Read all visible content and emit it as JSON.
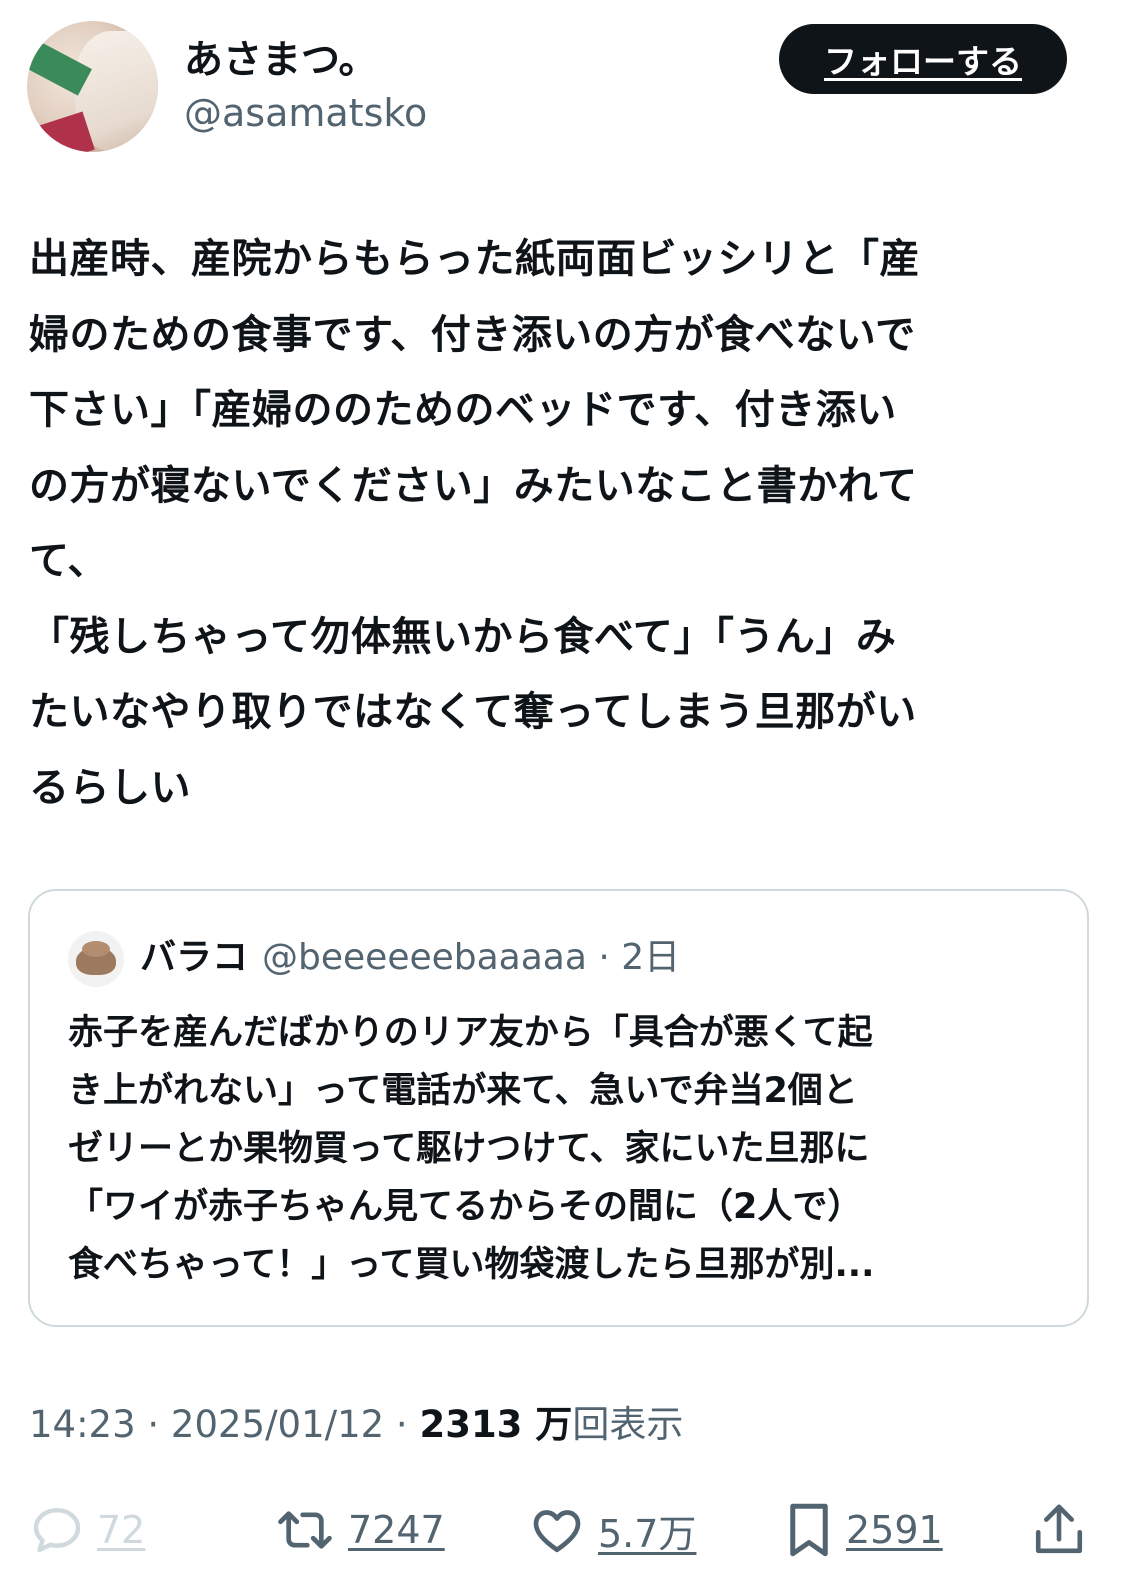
{
  "author": {
    "display_name": "あさまつ。",
    "handle": "@asamatsko"
  },
  "follow_button": {
    "label": "フォローする"
  },
  "tweet": {
    "text": "出産時、産院からもらった紙両面ビッシリと「産\n婦のための食事です、付き添いの方が食べないで\n下さい」「産婦ののためのベッドです、付き添い\nの方が寝ないでください」みたいなこと書かれて\nて、\n「残しちゃって勿体無いから食べて」「うん」み\nたいなやり取りではなくて奪ってしまう旦那がい\nるらしい"
  },
  "quote": {
    "name": "バラコ",
    "meta": "@beeeeeebaaaaa · 2日",
    "text": "赤子を産んだばかりのリア友から「具合が悪くて起\nき上がれない」って電話が来て、急いで弁当2個と\nゼリーとか果物買って駆けつけて、家にいた旦那に\n「ワイが赤子ちゃん見てるからその間に（2人で）\n食べちゃって！」って買い物袋渡したら旦那が別..."
  },
  "timestamp": {
    "time_date": "14:23 · 2025/01/12 · ",
    "views_count": "2313 万",
    "views_label": "回表示"
  },
  "actions": {
    "reply_count": "72",
    "retweet_count": "7247",
    "like_count": "5.7万",
    "bookmark_count": "2591"
  },
  "colors": {
    "text_primary": "#0f1419",
    "text_secondary": "#536471",
    "border": "#cfd9de",
    "follow_bg": "#0f1419"
  }
}
